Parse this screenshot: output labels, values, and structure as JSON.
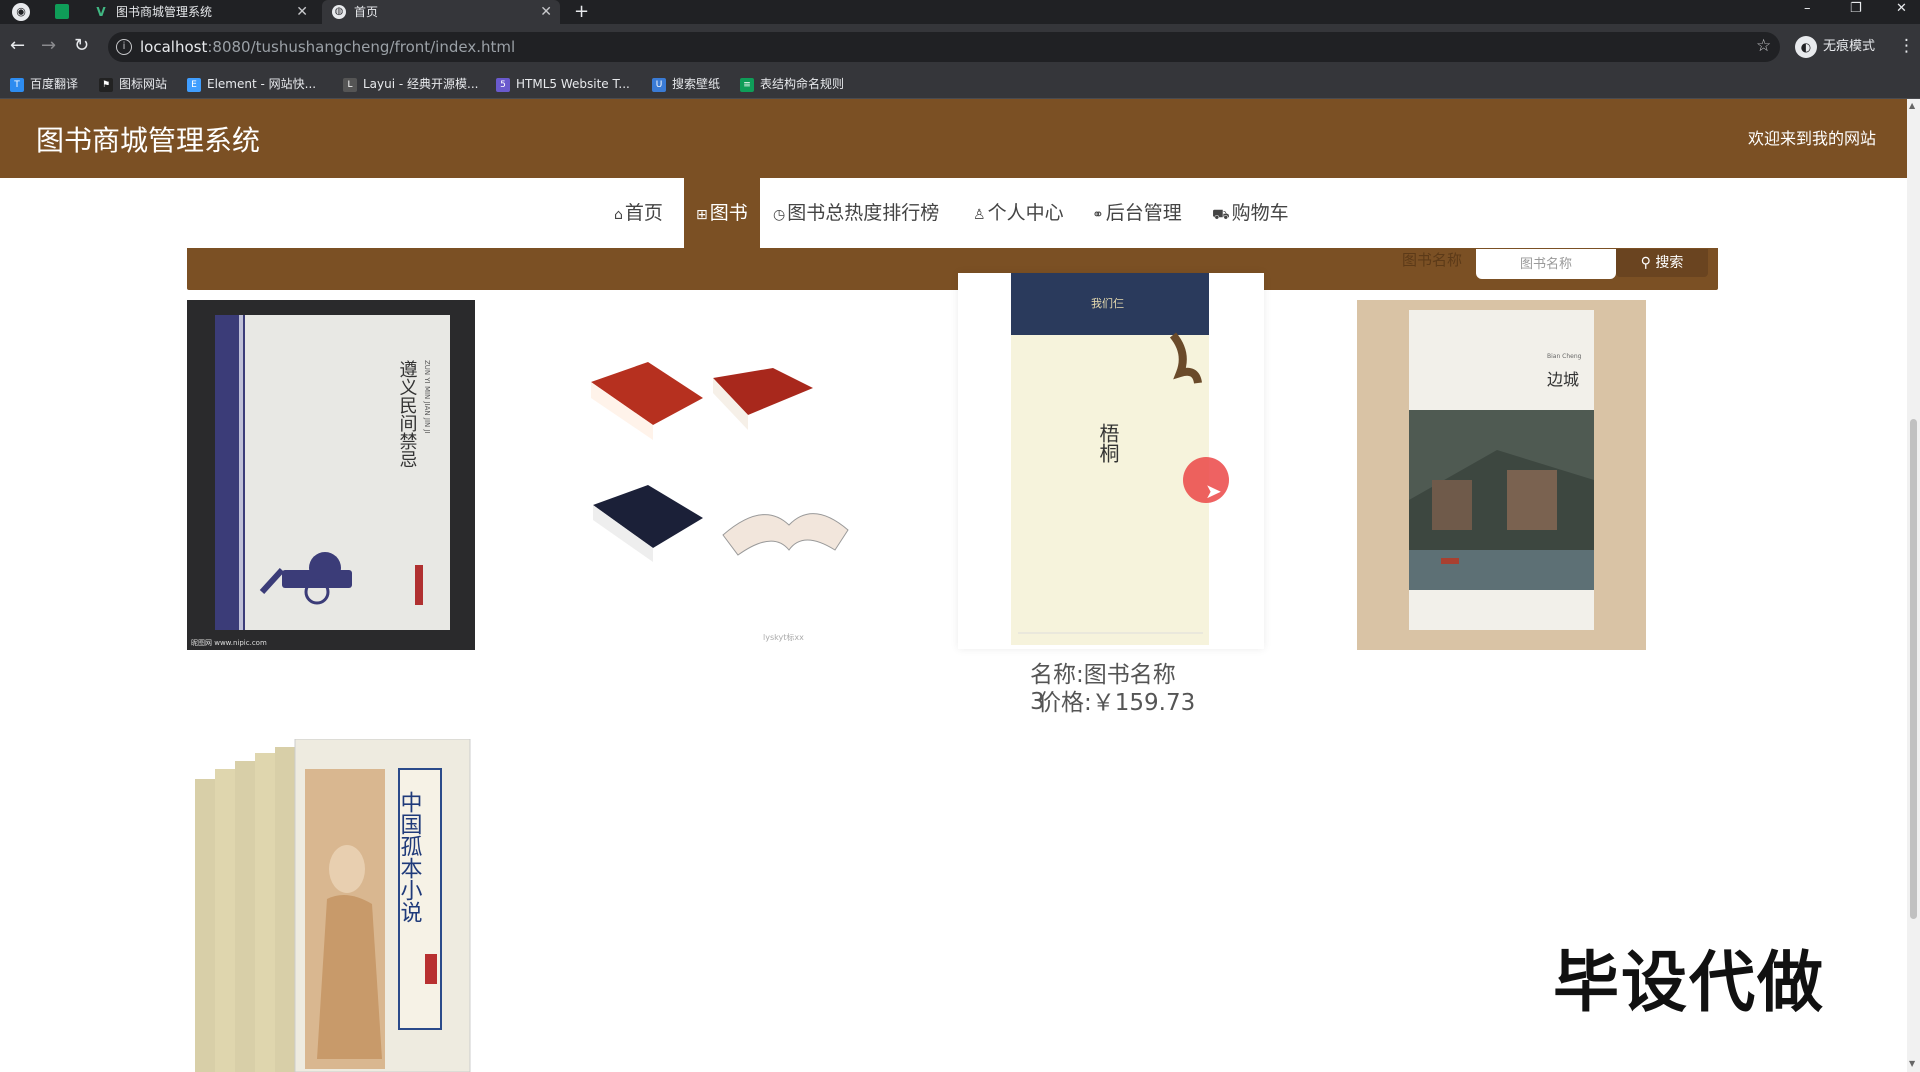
{
  "browser": {
    "tabs": [
      {
        "title": "图书商城管理系统",
        "active": false
      },
      {
        "title": "首页",
        "active": true
      }
    ],
    "url_host": "localhost",
    "url_rest": ":8080/tushushangcheng/front/index.html",
    "incognito_label": "无痕模式",
    "window_controls": {
      "minimize": "–",
      "restore": "❐",
      "close": "✕"
    },
    "bookmarks": [
      "百度翻译",
      "图标网站",
      "Element - 网站快...",
      "Layui - 经典开源模...",
      "HTML5 Website T...",
      "搜索壁纸",
      "表结构命名规则"
    ]
  },
  "site": {
    "title": "图书商城管理系统",
    "welcome": "欢迎来到我的网站",
    "accent_color": "#7b5024",
    "nav": [
      {
        "label": "首页",
        "icon": "home-icon",
        "glyph": "⌂"
      },
      {
        "label": "图书",
        "icon": "grid-icon",
        "glyph": "⊞",
        "active": true
      },
      {
        "label": "图书总热度排行榜",
        "icon": "clock-icon",
        "glyph": "◷"
      },
      {
        "label": "个人中心",
        "icon": "user-icon",
        "glyph": "♙"
      },
      {
        "label": "后台管理",
        "icon": "link-icon",
        "glyph": "⚭"
      },
      {
        "label": "购物车",
        "icon": "cart-icon",
        "glyph": "⛟"
      }
    ]
  },
  "search": {
    "label": "图书名称",
    "placeholder": "图书名称",
    "button_label": "搜索"
  },
  "books": [
    {
      "cover_title": "遵义民间禁忌",
      "cover_sub": "ZUN YI MIN JIAN JIN JI",
      "credit": "昵图网 www.nipic.com"
    },
    {
      "cover_title": "",
      "credit": "lyskyt标xx"
    },
    {
      "cover_title": "梧桐",
      "cover_top": "我们仨",
      "name": "名称:图书名称3",
      "price": "价格:￥159.73",
      "hovered": true
    },
    {
      "cover_title": "边城",
      "cover_sub": "Bian Cheng"
    },
    {
      "cover_title": "中国孤本小说"
    }
  ],
  "watermark": "毕设代做"
}
